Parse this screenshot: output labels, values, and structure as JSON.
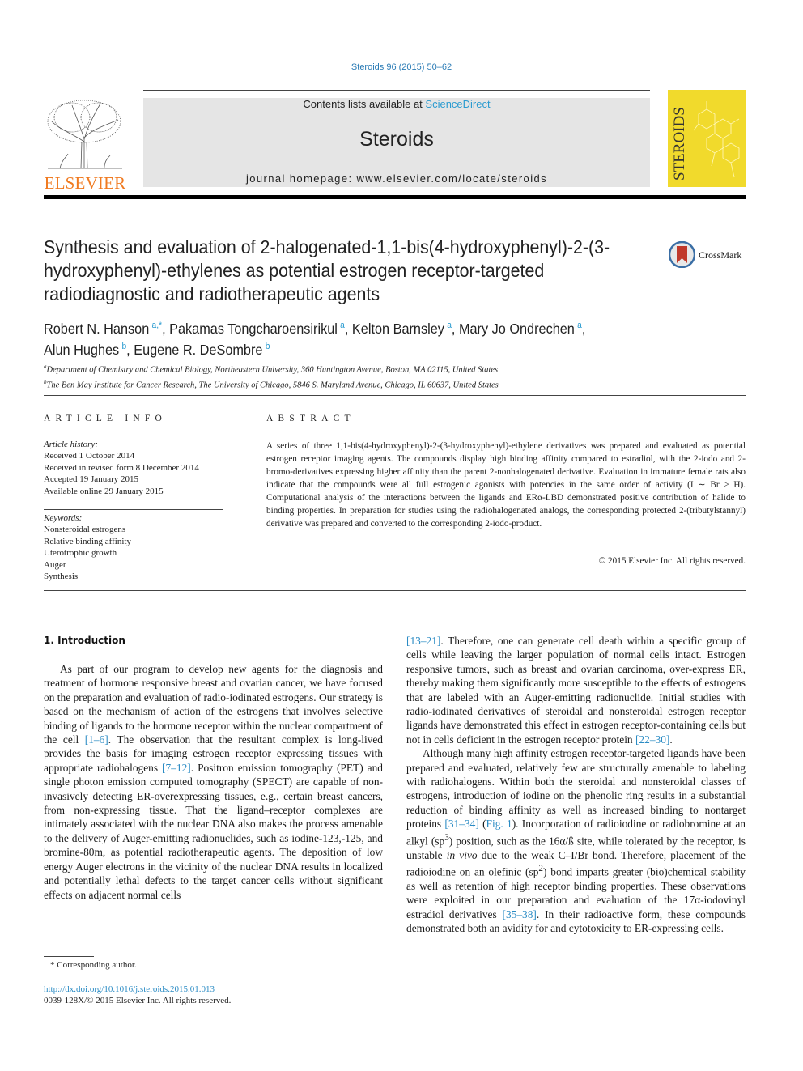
{
  "header": {
    "citation": "Steroids 96 (2015) 50–62",
    "contents_prefix": "Contents lists available at ",
    "contents_link": "ScienceDirect",
    "journal_title": "Steroids",
    "homepage": "journal homepage: www.elsevier.com/locate/steroids",
    "publisher_logo": "ELSEVIER",
    "cover_title": "STEROIDS"
  },
  "article": {
    "title": "Synthesis and evaluation of 2-halogenated-1,1-bis(4-hydroxyphenyl)-2-(3-hydroxyphenyl)-ethylenes as potential estrogen receptor-targeted radiodiagnostic and radiotherapeutic agents",
    "crossmark_label": "CrossMark",
    "authors": [
      {
        "name": "Robert N. Hanson",
        "aff": "a,*"
      },
      {
        "name": "Pakamas Tongcharoensirikul",
        "aff": "a"
      },
      {
        "name": "Kelton Barnsley",
        "aff": "a"
      },
      {
        "name": "Mary Jo Ondrechen",
        "aff": "a"
      },
      {
        "name": "Alun Hughes",
        "aff": "b"
      },
      {
        "name": "Eugene R. DeSombre",
        "aff": "b"
      }
    ],
    "affiliations": [
      {
        "key": "a",
        "text": "Department of Chemistry and Chemical Biology, Northeastern University, 360 Huntington Avenue, Boston, MA 02115, United States"
      },
      {
        "key": "b",
        "text": "The Ben May Institute for Cancer Research, The University of Chicago, 5846 S. Maryland Avenue, Chicago, IL 60637, United States"
      }
    ]
  },
  "article_info": {
    "heading": "ARTICLE INFO",
    "history_label": "Article history:",
    "history": [
      "Received 1 October 2014",
      "Received in revised form 8 December 2014",
      "Accepted 19 January 2015",
      "Available online 29 January 2015"
    ],
    "keywords_label": "Keywords:",
    "keywords": [
      "Nonsteroidal estrogens",
      "Relative binding affinity",
      "Uterotrophic growth",
      "Auger",
      "Synthesis"
    ]
  },
  "abstract": {
    "heading": "ABSTRACT",
    "text": "A series of three 1,1-bis(4-hydroxyphenyl)-2-(3-hydroxyphenyl)-ethylene derivatives was prepared and evaluated as potential estrogen receptor imaging agents. The compounds display high binding affinity compared to estradiol, with the 2-iodo and 2-bromo-derivatives expressing higher affinity than the parent 2-nonhalogenated derivative. Evaluation in immature female rats also indicate that the compounds were all full estrogenic agonists with potencies in the same order of activity (I ∼ Br > H). Computational analysis of the interactions between the ligands and ERα-LBD demonstrated positive contribution of halide to binding properties. In preparation for studies using the radiohalogenated analogs, the corresponding protected 2-(tributylstannyl) derivative was prepared and converted to the corresponding 2-iodo-product.",
    "copyright": "© 2015 Elsevier Inc. All rights reserved."
  },
  "introduction": {
    "heading": "1. Introduction",
    "left": {
      "p1_a": "As part of our program to develop new agents for the diagnosis and treatment of hormone responsive breast and ovarian cancer, we have focused on the preparation and evaluation of radio-iodinated estrogens. Our strategy is based on the mechanism of action of the estrogens that involves selective binding of ligands to the hormone receptor within the nuclear compartment of the cell ",
      "ref1": "[1–6]",
      "p1_b": ". The observation that the resultant complex is long-lived provides the basis for imaging estrogen receptor expressing tissues with appropriate radiohalogens ",
      "ref2": "[7–12]",
      "p1_c": ". Positron emission tomography (PET) and single photon emission computed tomography (SPECT) are capable of non-invasively detecting ER-overexpressing tissues, e.g., certain breast cancers, from non-expressing tissue. That the ligand–receptor complexes are intimately associated with the nuclear DNA also makes the process amenable to the delivery of Auger-emitting radionuclides, such as iodine-123,-125, and bromine-80m, as potential radiotherapeutic agents. The deposition of low energy Auger electrons in the vicinity of the nuclear DNA results in localized and potentially lethal defects to the target cancer cells without significant effects on adjacent normal cells"
    },
    "right": {
      "ref3": "[13–21]",
      "p1_d": ". Therefore, one can generate cell death within a specific group of cells while leaving the larger population of normal cells intact. Estrogen responsive tumors, such as breast and ovarian carcinoma, over-express ER, thereby making them significantly more susceptible to the effects of estrogens that are labeled with an Auger-emitting radionuclide. Initial studies with radio-iodinated derivatives of steroidal and nonsteroidal estrogen receptor ligands have demonstrated this effect in estrogen receptor-containing cells but not in cells deficient in the estrogen receptor protein ",
      "ref4": "[22–30]",
      "p1_e": ".",
      "p2_a": "Although many high affinity estrogen receptor-targeted ligands have been prepared and evaluated, relatively few are structurally amenable to labeling with radiohalogens. Within both the steroidal and nonsteroidal classes of estrogens, introduction of iodine on the phenolic ring results in a substantial reduction of binding affinity as well as increased binding to nontarget proteins ",
      "ref5": "[31–34]",
      "p2_b": " (",
      "ref6": "Fig. 1",
      "p2_c": "). Incorporation of radioiodine or radiobromine at an alkyl (sp",
      "sup1": "3",
      "p2_d": ") position, such as the 16α/ß site, while tolerated by the receptor, is unstable ",
      "italic1": "in vivo",
      "p2_e": " due to the weak C–I/Br bond. Therefore, placement of the radioiodine on an olefinic (sp",
      "sup2": "2",
      "p2_f": ") bond imparts greater (bio)chemical stability as well as retention of high receptor binding properties. These observations were exploited in our preparation and evaluation of the 17α-iodovinyl estradiol derivatives ",
      "ref7": "[35–38]",
      "p2_g": ". In their radioactive form, these compounds demonstrated both an avidity for and cytotoxicity to ER-expressing cells."
    }
  },
  "footer": {
    "footnote": "* Corresponding author.",
    "doi": "http://dx.doi.org/10.1016/j.steroids.2015.01.013",
    "issn": "0039-128X/© 2015 Elsevier Inc. All rights reserved."
  },
  "colors": {
    "link": "#2a8bc4",
    "elsevier_orange": "#f07a20",
    "cover_yellow": "#f1da2c",
    "banner_gray": "#e5e5e5"
  }
}
